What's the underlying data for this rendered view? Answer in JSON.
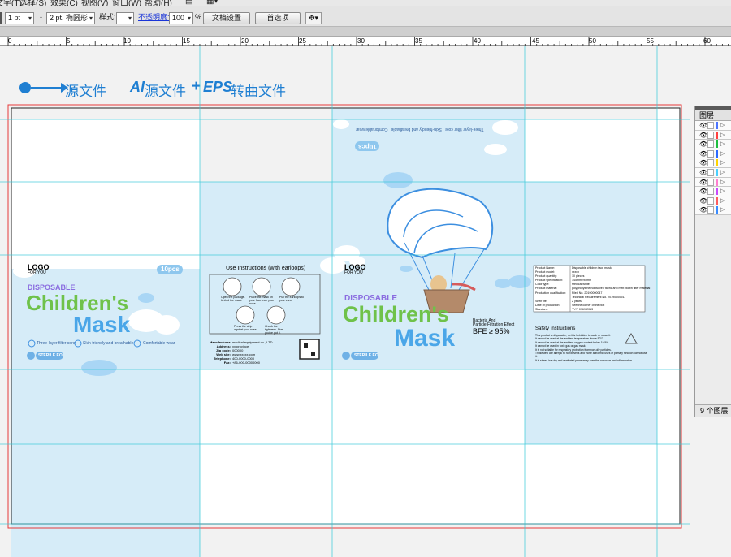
{
  "menubar": {
    "items": [
      "文字(T)",
      "选择(S)",
      "效果(C)",
      "视图(V)",
      "窗口(W)",
      "帮助(H)"
    ]
  },
  "controlbar": {
    "stroke_weight": "1 pt",
    "brush_label": "2 pt. 椭圆形",
    "style_label": "样式:",
    "opacity_label": "不透明度:",
    "opacity_value": "100",
    "percent": "%",
    "doc_setup_button": "文档设置",
    "preferences_button": "首选项"
  },
  "ruler": {
    "ticks": [
      "0",
      "5",
      "10",
      "15",
      "20",
      "25",
      "30",
      "35",
      "40",
      "45",
      "50",
      "55",
      "60"
    ]
  },
  "canvas": {
    "heading_left": "源文件",
    "heading_right_ai": "AI",
    "heading_right_mid": "源文件",
    "heading_right_plus": "+",
    "heading_right_eps": "EPS",
    "heading_right_tail": "转曲文件"
  },
  "package": {
    "logo": "LOGO",
    "logo_sub": "FOR YOU",
    "disposable": "DISPOSABLE",
    "title_line1": "Children's",
    "title_line2": "Mask",
    "count_badge": "10pcs",
    "feature1": "Three-layer filter core",
    "feature2": "Skin-friendly and breathable",
    "feature3": "Comfortable wear",
    "sterile": "STERILE EO",
    "usage_title": "Use Instructions (with earloops)",
    "usage_steps": [
      "Open the package. Unfold the mask.",
      "Place the mask on your face over your nose.",
      "Pull the earloops to your ears.",
      "Press the strip against your nose.",
      "Check the tightness. Now you've got it."
    ],
    "info_labels": [
      "Manufacturer:",
      "Address:",
      "Zip code:",
      "Web site:",
      "Telephone:",
      "Fax:"
    ],
    "info_values": [
      "medical equipment co., LTD",
      "xx province",
      "000000",
      "www.xxxxx.com",
      "400-0000-0000",
      "+86-000-00000000"
    ],
    "bacteria_line1": "Bacteria And",
    "bacteria_line2": "Particle Filtration Effect",
    "bfe": "BFE ≥ 95%",
    "spec_rows": [
      [
        "Product Name:",
        "Disposable children face mask"
      ],
      [
        "Product model:",
        "xxxxx"
      ],
      [
        "Product quantity:",
        "10 pieces"
      ],
      [
        "Product specification:",
        "145mm×95mm"
      ],
      [
        "Color type:",
        "Medical white"
      ],
      [
        "Product material:",
        "polypropylene nonwoven fabric and melt blown filter material"
      ],
      [
        "Production qualification:",
        "Filed No. 20190000047"
      ],
      [
        "",
        "Technical Requirement No. 20190000047"
      ],
      [
        "Shelf life:",
        "2 years"
      ],
      [
        "Date of production:",
        "See the corner of the box"
      ],
      [
        "Standard:",
        "YY/T 0969-2013"
      ]
    ],
    "safety_title": "Safety Instructions",
    "safety_items": [
      "This product is disposable, so it is forbidden to wash or reuse it.",
      "It cannot be used at the ambient temperature above 50°C.",
      "It cannot be used at the ambient oxygen content below 19.5%.",
      "It cannot be used in toxic gas or gas mask.",
      "It is not suitable for respiratory protection from non-oily particles.",
      "Those who are allergic to nonwovens and those abnormal uses of primary function cannot use it.",
      "It is stored in a dry and ventilated place away from the corrosive and inflammation."
    ],
    "top_flap_text": [
      "Three-layer filter core",
      "Skin-friendly and breathable",
      "Comfortable wear"
    ]
  },
  "layers_panel": {
    "tab": "图层",
    "colors": [
      "#4a74ff",
      "#ff4040",
      "#1fbf3f",
      "#2d6cff",
      "#ffd400",
      "#4ad0ff",
      "#ff7fcf",
      "#c94aff",
      "#ff5e5e",
      "#3a8cff"
    ],
    "footer": "9 个图层"
  }
}
